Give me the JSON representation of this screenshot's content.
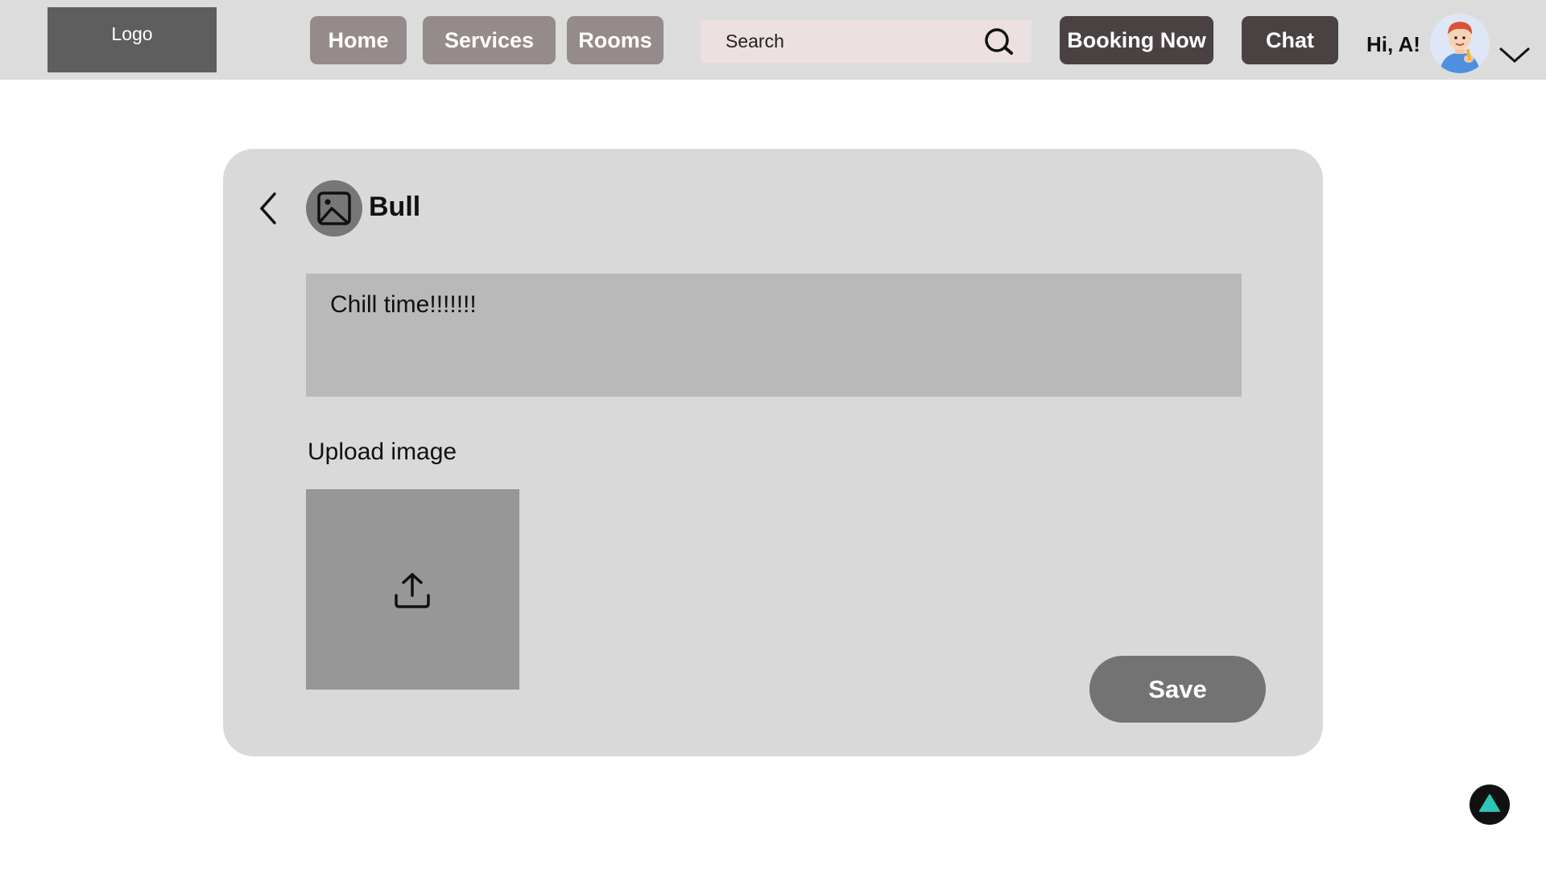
{
  "header": {
    "logo_text": "Logo",
    "nav": {
      "home": "Home",
      "services": "Services",
      "rooms": "Rooms"
    },
    "search": {
      "placeholder": "Search",
      "value": ""
    },
    "booking_label": "Booking Now",
    "chat_label": "Chat",
    "greeting": "Hi, A!",
    "icons": {
      "search": "search-icon",
      "user_menu": "chevron-down-icon",
      "avatar": "avatar-image"
    }
  },
  "post_editor": {
    "author_name": "Bull",
    "caption": "Chill time!!!!!!!",
    "upload_label": "Upload image",
    "save_label": "Save",
    "icons": {
      "back": "chevron-left-icon",
      "author_avatar": "image-placeholder-icon",
      "upload": "upload-icon"
    }
  },
  "scroll_top": {
    "icon": "triangle-up-icon",
    "color": "#2ec4b6"
  },
  "colors": {
    "topbar_bg": "#dcdcdc",
    "nav_button": "#958b8b",
    "dark_button": "#4a4242",
    "card_bg": "#d9d9d9",
    "save_button": "#737373"
  }
}
